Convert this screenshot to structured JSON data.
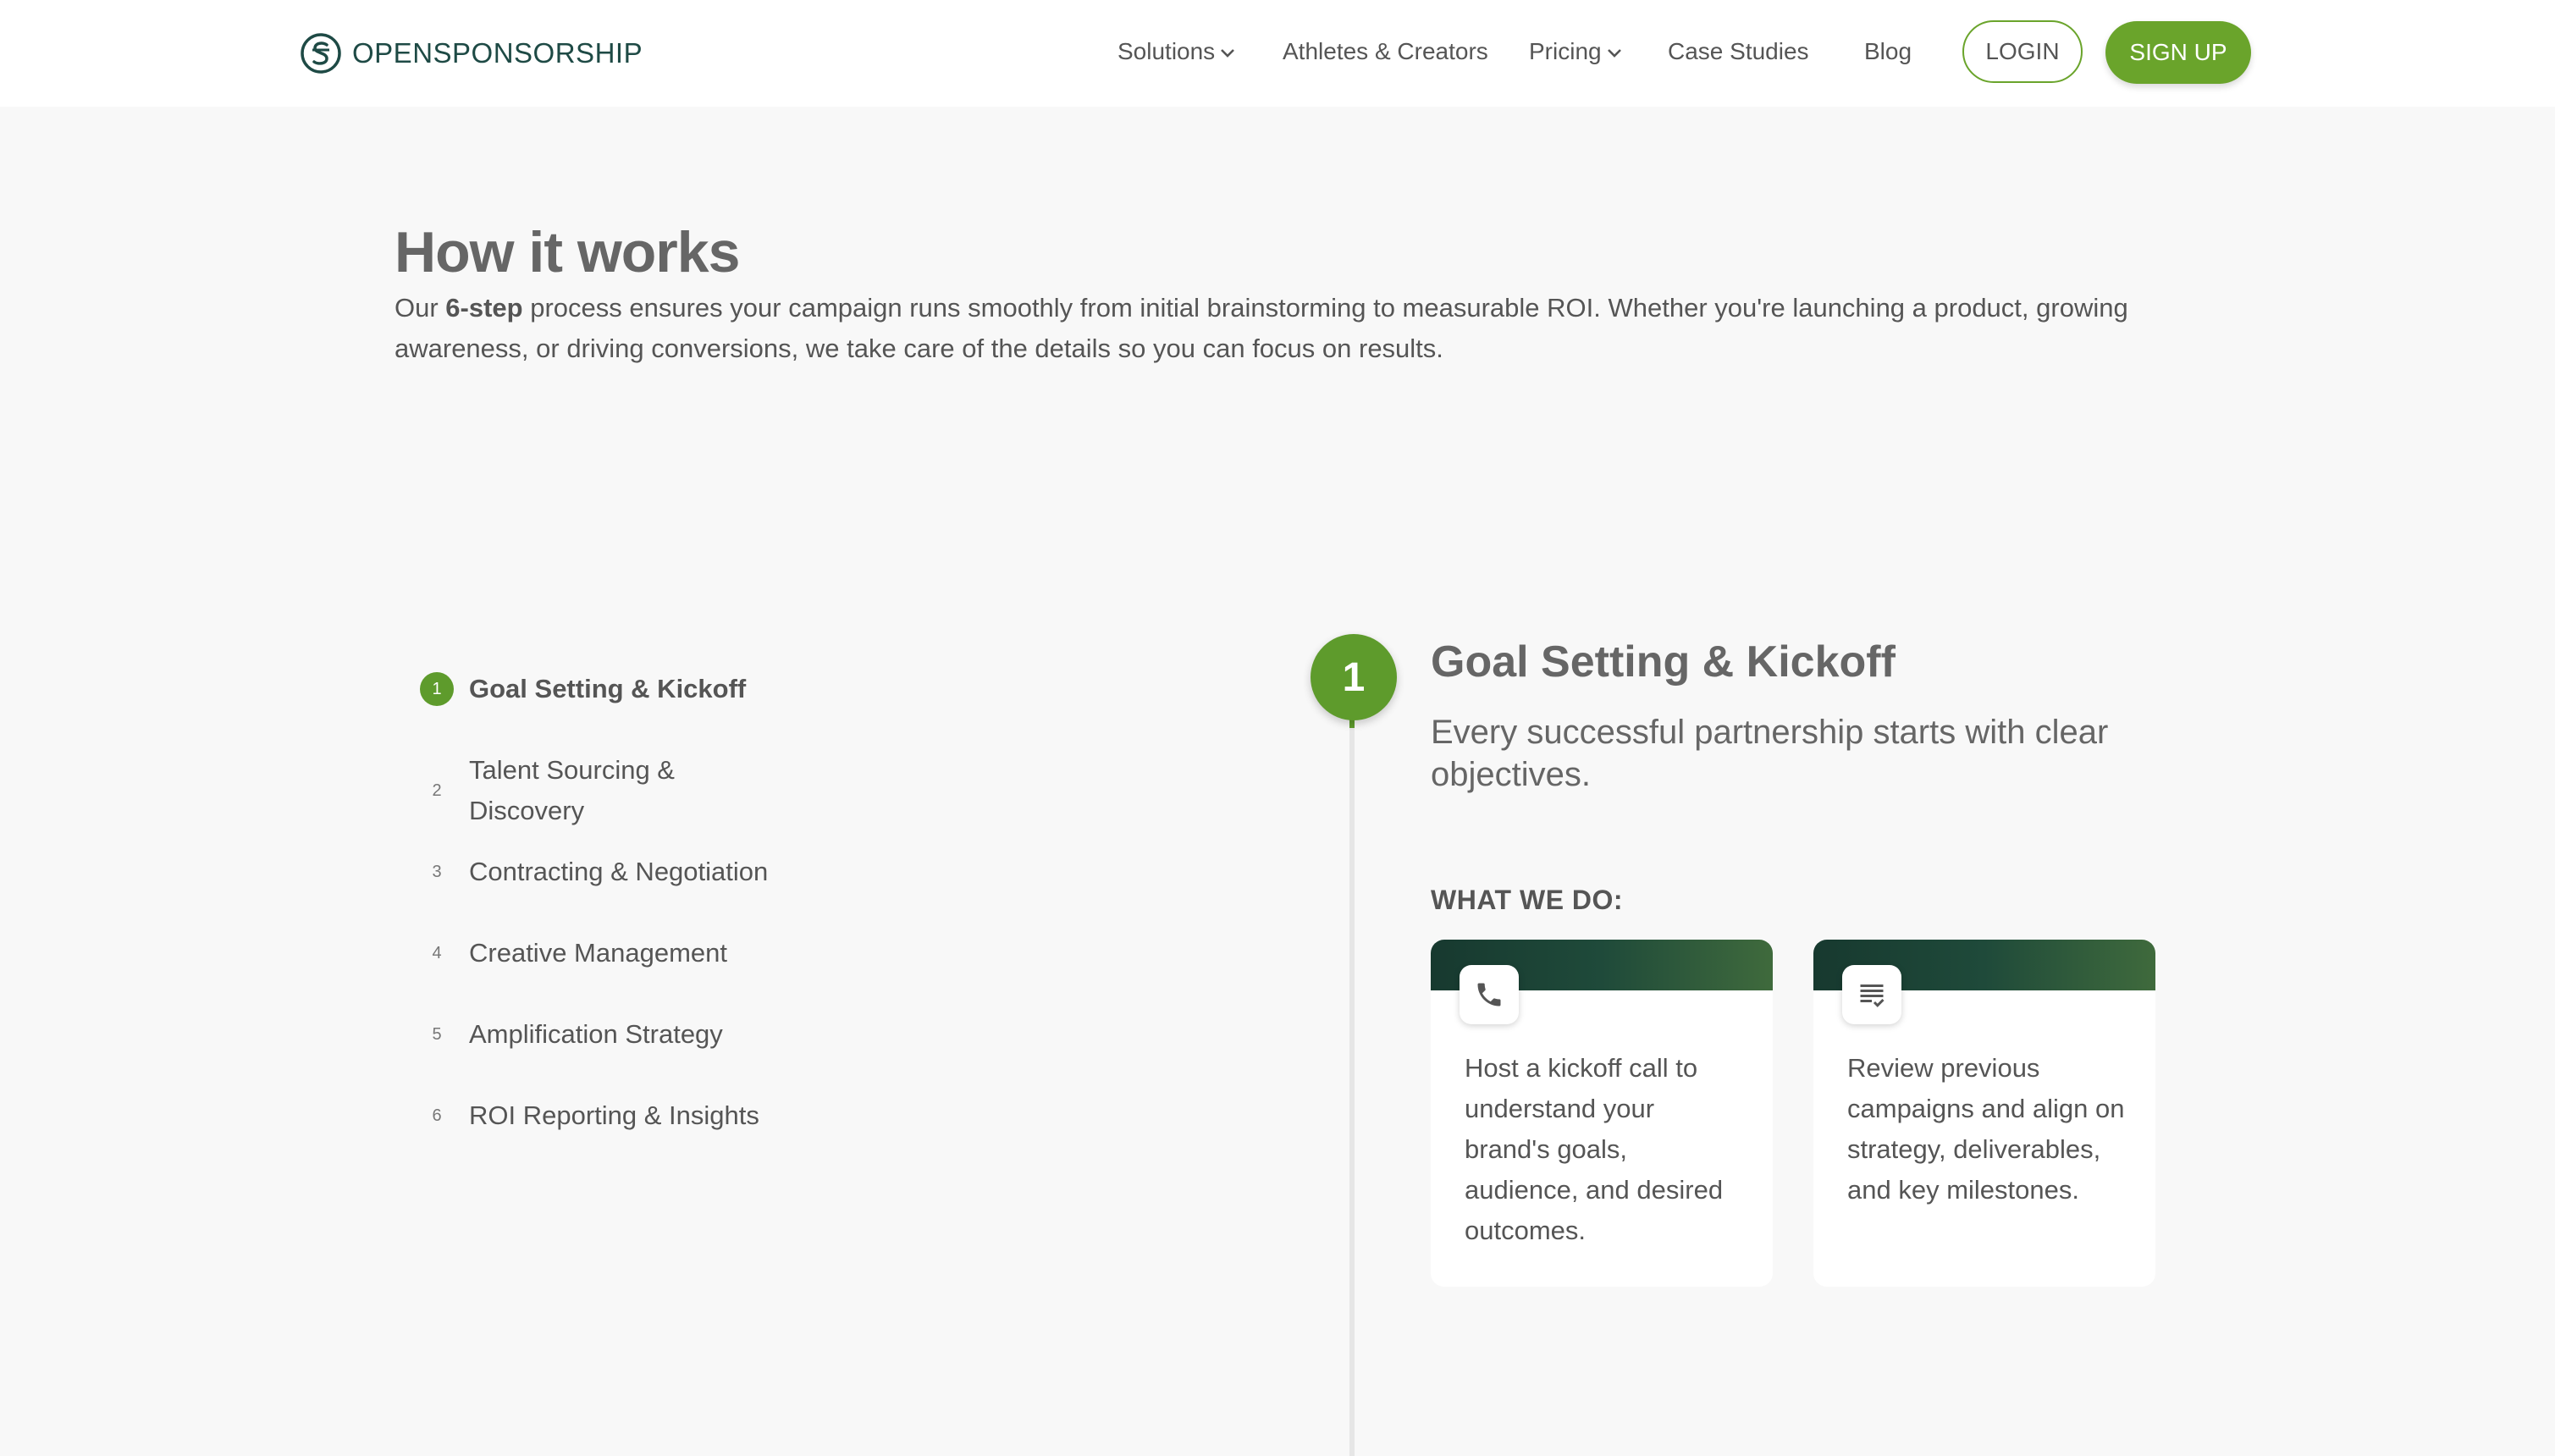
{
  "brand": {
    "name": "OPENSPONSORSHIP",
    "accent": "#6aa42b",
    "dark": "#1e4a45"
  },
  "nav": {
    "items": [
      {
        "label": "Solutions",
        "has_dropdown": true
      },
      {
        "label": "Athletes & Creators",
        "has_dropdown": false
      },
      {
        "label": "Pricing",
        "has_dropdown": true
      },
      {
        "label": "Case Studies",
        "has_dropdown": false
      },
      {
        "label": "Blog",
        "has_dropdown": false
      }
    ],
    "login_label": "LOGIN",
    "signup_label": "SIGN UP"
  },
  "section": {
    "title": "How it works",
    "intro_prefix": "Our ",
    "intro_bold": "6-step",
    "intro_suffix": " process ensures your campaign runs smoothly from initial brainstorming to measurable ROI. Whether you're launching a product, growing awareness, or driving conversions, we take care of the details so you can focus on results."
  },
  "steps": [
    {
      "num": "1",
      "label": "Goal Setting & Kickoff",
      "active": true
    },
    {
      "num": "2",
      "label": "Talent Sourcing & Discovery",
      "active": false
    },
    {
      "num": "3",
      "label": "Contracting & Negotiation",
      "active": false
    },
    {
      "num": "4",
      "label": "Creative Management",
      "active": false
    },
    {
      "num": "5",
      "label": "Amplification Strategy",
      "active": false
    },
    {
      "num": "6",
      "label": "ROI Reporting & Insights",
      "active": false
    }
  ],
  "detail": {
    "badge": "1",
    "title": "Goal Setting & Kickoff",
    "subtitle": "Every successful partnership starts with clear objectives.",
    "what_we_do_label": "WHAT WE DO:",
    "cards": [
      {
        "icon": "phone-icon",
        "text": "Host a kickoff call to understand your brand's goals, audience, and desired outcomes."
      },
      {
        "icon": "checklist-icon",
        "text": "Review previous campaigns and align on strategy, deliverables, and key milestones."
      }
    ]
  }
}
